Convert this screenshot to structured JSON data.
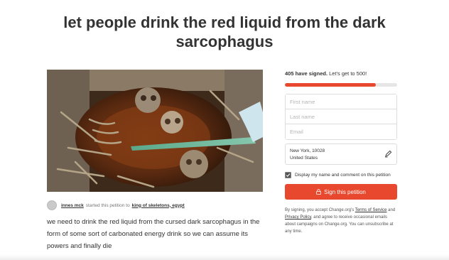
{
  "petition": {
    "title_line1": "let people drink the red liquid from the dark",
    "title_line2": "sarcophagus",
    "starter_name": "innes mck",
    "starter_mid": "started this petition to",
    "target": "king of skeletons, egypt",
    "description": "we need to drink the red liquid from the cursed dark sarcophagus in the form of some sort of carbonated energy drink so we can assume its powers and finally die",
    "photo_icon": "sarcophagus-photo"
  },
  "signing": {
    "count_text": "405 have signed.",
    "goal_text": "Let's get to 500!",
    "progress": 0.81,
    "first_name_placeholder": "First name",
    "last_name_placeholder": "Last name",
    "email_placeholder": "Email",
    "location_city": "New York, 10028",
    "location_country": "United States",
    "display_label": "Display my name and comment on this petition",
    "display_checked": true,
    "sign_button": "Sign this petition",
    "legal_1": "By signing, you accept Change.org's",
    "legal_terms": "Terms of Service",
    "legal_2": "and",
    "legal_privacy": "Privacy Policy",
    "legal_3": ", and agree to receive occasional emails about campaigns on Change.org. You can unsubscribe at any time."
  },
  "colors": {
    "accent": "#e8492e",
    "text": "#333333",
    "border": "#dddddd"
  }
}
